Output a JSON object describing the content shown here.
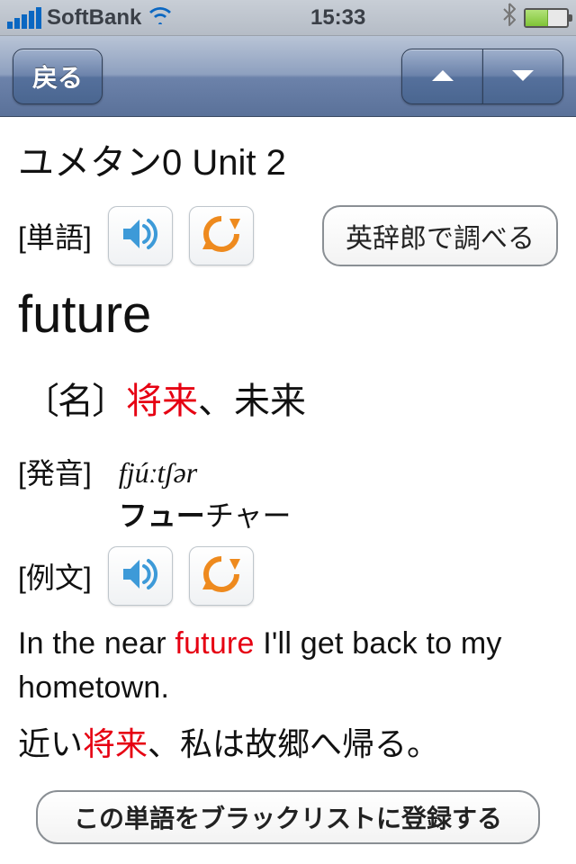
{
  "status": {
    "carrier": "SoftBank",
    "time": "15:33"
  },
  "nav": {
    "back_label": "戻る"
  },
  "page": {
    "title": "ユメタン0  Unit 2",
    "section_word": "[単語]",
    "dict_button": "英辞郎で調べる",
    "word_en": "future",
    "pos": "〔名〕",
    "meaning_highlight": "将来",
    "meaning_rest": "、未来",
    "section_pron": "[発音]",
    "ipa": "fjúːtʃər",
    "kana_bold": "フュー",
    "kana_rest": "チャー",
    "section_example": "[例文]",
    "example_en_pre": "In the near ",
    "example_en_hl": "future",
    "example_en_post": " I'll get back to my hometown.",
    "example_jp_pre": "近い",
    "example_jp_hl": "将来",
    "example_jp_post": "、私は故郷へ帰る。",
    "blacklist_button": "この単語をブラックリストに登録する"
  }
}
